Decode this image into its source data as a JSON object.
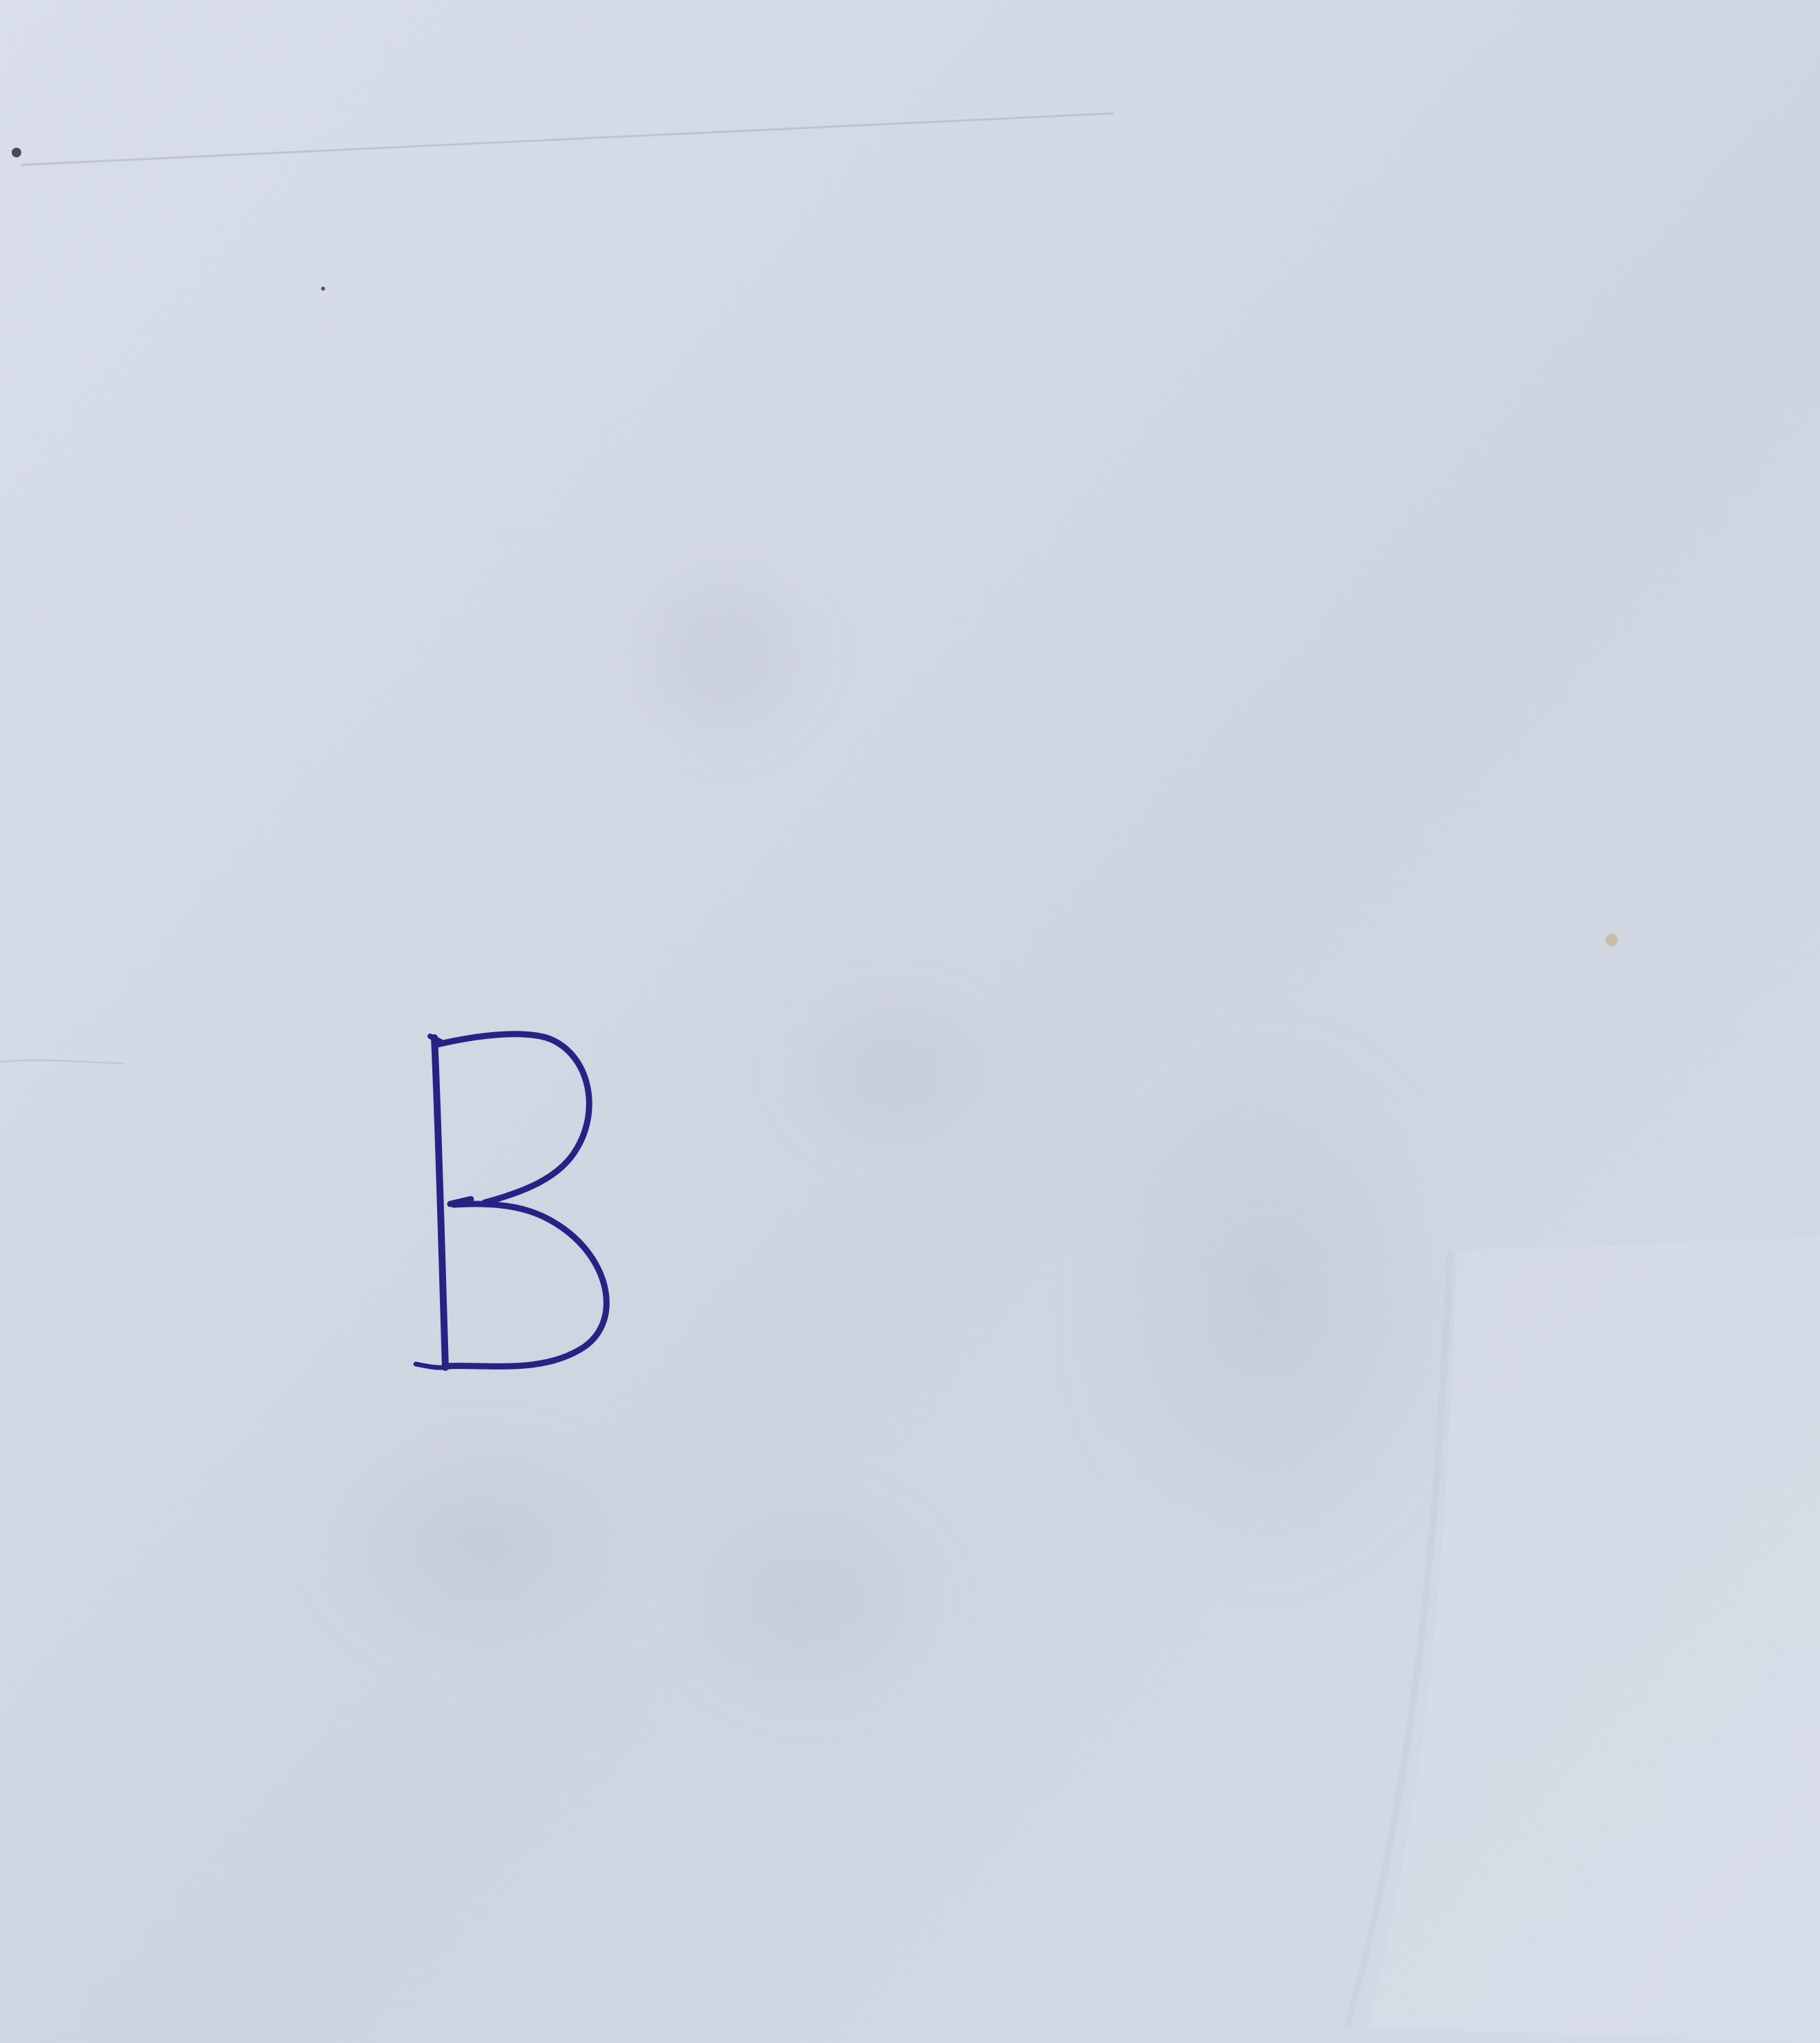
{
  "photo": {
    "subject": "handwritten-letter-on-paper",
    "handwritten_text": "B",
    "colors": {
      "paper_light": "#dde3ee",
      "paper_mid": "#d1d8e4",
      "paper_shadow": "#c3cad5",
      "ink": "#2a2185"
    }
  }
}
